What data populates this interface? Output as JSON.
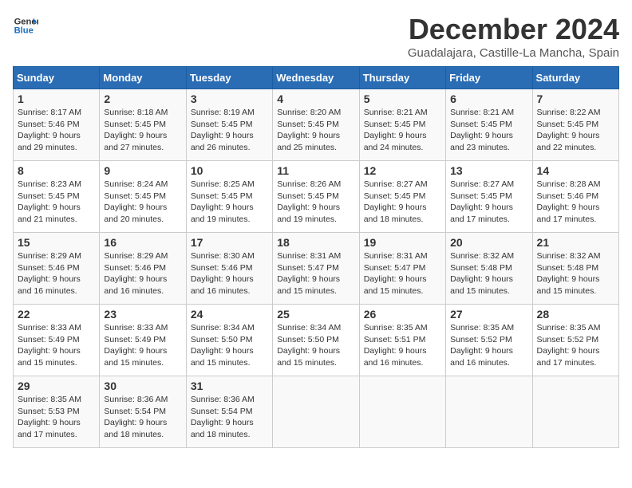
{
  "header": {
    "logo_line1": "General",
    "logo_line2": "Blue",
    "title": "December 2024",
    "subtitle": "Guadalajara, Castille-La Mancha, Spain"
  },
  "days_of_week": [
    "Sunday",
    "Monday",
    "Tuesday",
    "Wednesday",
    "Thursday",
    "Friday",
    "Saturday"
  ],
  "weeks": [
    [
      {
        "day": "1",
        "sunrise": "8:17 AM",
        "sunset": "5:46 PM",
        "daylight": "9 hours and 29 minutes."
      },
      {
        "day": "2",
        "sunrise": "8:18 AM",
        "sunset": "5:45 PM",
        "daylight": "9 hours and 27 minutes."
      },
      {
        "day": "3",
        "sunrise": "8:19 AM",
        "sunset": "5:45 PM",
        "daylight": "9 hours and 26 minutes."
      },
      {
        "day": "4",
        "sunrise": "8:20 AM",
        "sunset": "5:45 PM",
        "daylight": "9 hours and 25 minutes."
      },
      {
        "day": "5",
        "sunrise": "8:21 AM",
        "sunset": "5:45 PM",
        "daylight": "9 hours and 24 minutes."
      },
      {
        "day": "6",
        "sunrise": "8:21 AM",
        "sunset": "5:45 PM",
        "daylight": "9 hours and 23 minutes."
      },
      {
        "day": "7",
        "sunrise": "8:22 AM",
        "sunset": "5:45 PM",
        "daylight": "9 hours and 22 minutes."
      }
    ],
    [
      {
        "day": "8",
        "sunrise": "8:23 AM",
        "sunset": "5:45 PM",
        "daylight": "9 hours and 21 minutes."
      },
      {
        "day": "9",
        "sunrise": "8:24 AM",
        "sunset": "5:45 PM",
        "daylight": "9 hours and 20 minutes."
      },
      {
        "day": "10",
        "sunrise": "8:25 AM",
        "sunset": "5:45 PM",
        "daylight": "9 hours and 19 minutes."
      },
      {
        "day": "11",
        "sunrise": "8:26 AM",
        "sunset": "5:45 PM",
        "daylight": "9 hours and 19 minutes."
      },
      {
        "day": "12",
        "sunrise": "8:27 AM",
        "sunset": "5:45 PM",
        "daylight": "9 hours and 18 minutes."
      },
      {
        "day": "13",
        "sunrise": "8:27 AM",
        "sunset": "5:45 PM",
        "daylight": "9 hours and 17 minutes."
      },
      {
        "day": "14",
        "sunrise": "8:28 AM",
        "sunset": "5:46 PM",
        "daylight": "9 hours and 17 minutes."
      }
    ],
    [
      {
        "day": "15",
        "sunrise": "8:29 AM",
        "sunset": "5:46 PM",
        "daylight": "9 hours and 16 minutes."
      },
      {
        "day": "16",
        "sunrise": "8:29 AM",
        "sunset": "5:46 PM",
        "daylight": "9 hours and 16 minutes."
      },
      {
        "day": "17",
        "sunrise": "8:30 AM",
        "sunset": "5:46 PM",
        "daylight": "9 hours and 16 minutes."
      },
      {
        "day": "18",
        "sunrise": "8:31 AM",
        "sunset": "5:47 PM",
        "daylight": "9 hours and 15 minutes."
      },
      {
        "day": "19",
        "sunrise": "8:31 AM",
        "sunset": "5:47 PM",
        "daylight": "9 hours and 15 minutes."
      },
      {
        "day": "20",
        "sunrise": "8:32 AM",
        "sunset": "5:48 PM",
        "daylight": "9 hours and 15 minutes."
      },
      {
        "day": "21",
        "sunrise": "8:32 AM",
        "sunset": "5:48 PM",
        "daylight": "9 hours and 15 minutes."
      }
    ],
    [
      {
        "day": "22",
        "sunrise": "8:33 AM",
        "sunset": "5:49 PM",
        "daylight": "9 hours and 15 minutes."
      },
      {
        "day": "23",
        "sunrise": "8:33 AM",
        "sunset": "5:49 PM",
        "daylight": "9 hours and 15 minutes."
      },
      {
        "day": "24",
        "sunrise": "8:34 AM",
        "sunset": "5:50 PM",
        "daylight": "9 hours and 15 minutes."
      },
      {
        "day": "25",
        "sunrise": "8:34 AM",
        "sunset": "5:50 PM",
        "daylight": "9 hours and 15 minutes."
      },
      {
        "day": "26",
        "sunrise": "8:35 AM",
        "sunset": "5:51 PM",
        "daylight": "9 hours and 16 minutes."
      },
      {
        "day": "27",
        "sunrise": "8:35 AM",
        "sunset": "5:52 PM",
        "daylight": "9 hours and 16 minutes."
      },
      {
        "day": "28",
        "sunrise": "8:35 AM",
        "sunset": "5:52 PM",
        "daylight": "9 hours and 17 minutes."
      }
    ],
    [
      {
        "day": "29",
        "sunrise": "8:35 AM",
        "sunset": "5:53 PM",
        "daylight": "9 hours and 17 minutes."
      },
      {
        "day": "30",
        "sunrise": "8:36 AM",
        "sunset": "5:54 PM",
        "daylight": "9 hours and 18 minutes."
      },
      {
        "day": "31",
        "sunrise": "8:36 AM",
        "sunset": "5:54 PM",
        "daylight": "9 hours and 18 minutes."
      },
      null,
      null,
      null,
      null
    ]
  ]
}
